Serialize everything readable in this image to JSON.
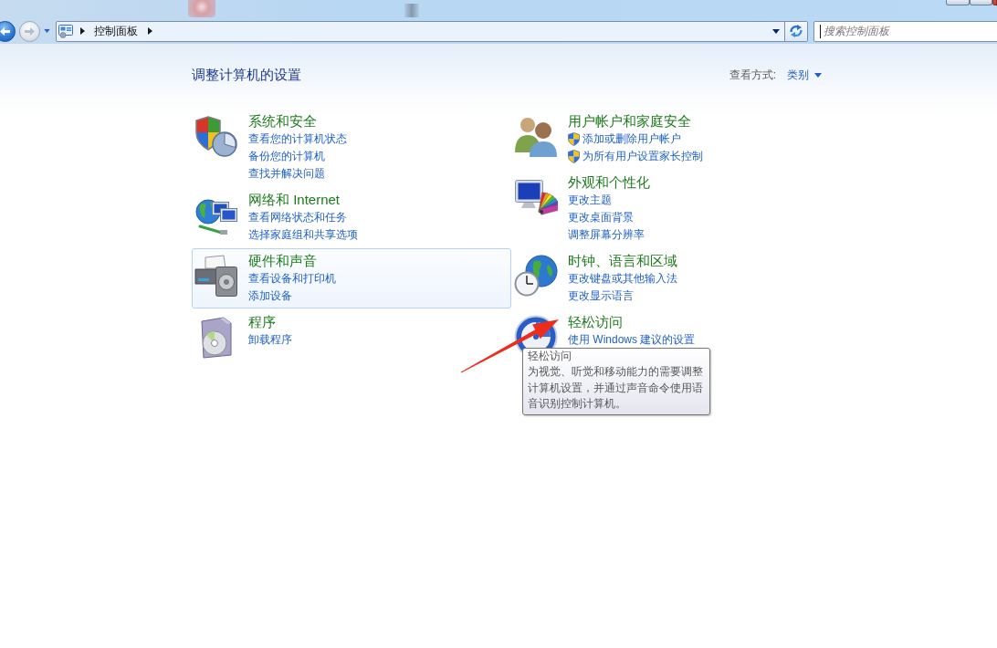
{
  "navigation": {
    "back": {
      "disabled": false
    },
    "forward": {
      "disabled": true
    }
  },
  "address_bar": {
    "breadcrumbs": [
      {
        "label": "控制面板"
      }
    ]
  },
  "search": {
    "placeholder": "搜索控制面板"
  },
  "page": {
    "title": "调整计算机的设置",
    "view_by": {
      "label": "查看方式:",
      "value": "类别"
    }
  },
  "columns": [
    {
      "categories": [
        {
          "kind": "security",
          "title": "系统和安全",
          "hovered": false,
          "links": [
            {
              "text": "查看您的计算机状态",
              "shield": false
            },
            {
              "text": "备份您的计算机",
              "shield": false
            },
            {
              "text": "查找并解决问题",
              "shield": false
            }
          ]
        },
        {
          "kind": "network",
          "title": "网络和 Internet",
          "hovered": false,
          "links": [
            {
              "text": "查看网络状态和任务",
              "shield": false
            },
            {
              "text": "选择家庭组和共享选项",
              "shield": false
            }
          ]
        },
        {
          "kind": "hardware",
          "title": "硬件和声音",
          "hovered": true,
          "links": [
            {
              "text": "查看设备和打印机",
              "shield": false
            },
            {
              "text": "添加设备",
              "shield": false
            }
          ]
        },
        {
          "kind": "programs",
          "title": "程序",
          "hovered": false,
          "links": [
            {
              "text": "卸载程序",
              "shield": false
            }
          ]
        }
      ]
    },
    {
      "categories": [
        {
          "kind": "accounts",
          "title": "用户帐户和家庭安全",
          "hovered": false,
          "links": [
            {
              "text": "添加或删除用户帐户",
              "shield": true
            },
            {
              "text": "为所有用户设置家长控制",
              "shield": true
            }
          ]
        },
        {
          "kind": "appearance",
          "title": "外观和个性化",
          "hovered": false,
          "links": [
            {
              "text": "更改主题",
              "shield": false
            },
            {
              "text": "更改桌面背景",
              "shield": false
            },
            {
              "text": "调整屏幕分辨率",
              "shield": false
            }
          ]
        },
        {
          "kind": "clock",
          "title": "时钟、语言和区域",
          "hovered": false,
          "links": [
            {
              "text": "更改键盘或其他输入法",
              "shield": false
            },
            {
              "text": "更改显示语言",
              "shield": false
            }
          ]
        },
        {
          "kind": "access",
          "title": "轻松访问",
          "hovered": false,
          "links": [
            {
              "text": "使用 Windows 建议的设置",
              "shield": false
            }
          ]
        }
      ]
    }
  ],
  "tooltip": {
    "title": "轻松访问",
    "text": "为视觉、听觉和移动能力的需要调整计算机设置，并通过声音命令使用语音识别控制计算机。"
  },
  "annotations": [
    {
      "kind": "arrow"
    }
  ]
}
